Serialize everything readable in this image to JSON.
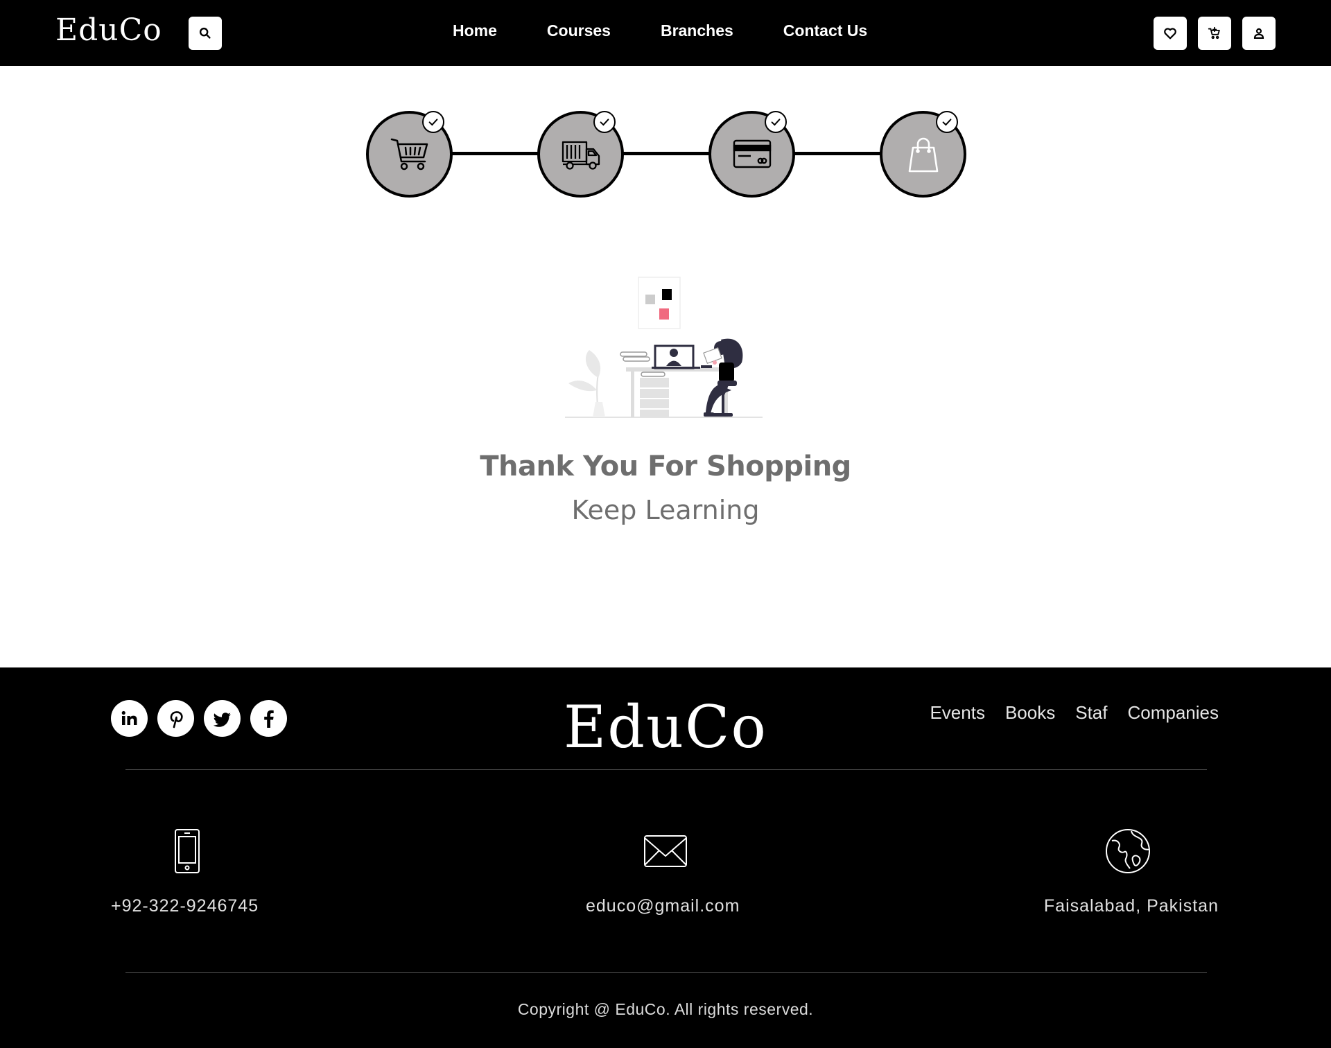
{
  "header": {
    "logo": "EduCo",
    "nav": [
      "Home",
      "Courses",
      "Branches",
      "Contact Us"
    ],
    "icons": [
      "search-icon",
      "heart-icon",
      "cart-icon",
      "user-icon"
    ]
  },
  "steps": [
    {
      "icon": "cart-icon",
      "completed": true
    },
    {
      "icon": "delivery-truck-icon",
      "completed": true
    },
    {
      "icon": "credit-card-icon",
      "completed": true
    },
    {
      "icon": "shopping-bag-icon",
      "completed": true
    }
  ],
  "main": {
    "title": "Thank You For Shopping",
    "subtitle": "Keep Learning"
  },
  "footer": {
    "logo": "EduCo",
    "social": [
      "linkedin-icon",
      "pinterest-icon",
      "twitter-icon",
      "facebook-icon"
    ],
    "links": [
      "Events",
      "Books",
      "Staf",
      "Companies"
    ],
    "phone": "+92-322-9246745",
    "email": "educo@gmail.com",
    "location": "Faisalabad, Pakistan",
    "copyright": "Copyright @ EduCo. All rights reserved."
  },
  "colors": {
    "header_bg": "#000000",
    "step_fill": "#b0aeae",
    "text_gray": "#6e6e6e",
    "accent_pink": "#f06a7f"
  }
}
